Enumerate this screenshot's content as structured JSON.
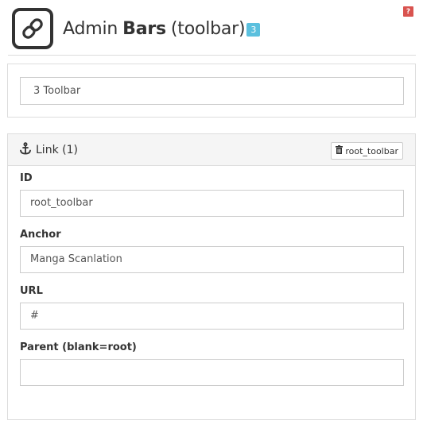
{
  "help_badge": "?",
  "header": {
    "title_pre": "Admin",
    "title_bold": "Bars",
    "title_post": "(toolbar)",
    "count": "3",
    "logo_icon": "link-icon"
  },
  "toolbar_select": {
    "value": "3 Toolbar"
  },
  "panel": {
    "title": "Link (1)",
    "title_icon": "anchor-icon",
    "delete_button": {
      "label": "root_toolbar",
      "icon": "trash-icon"
    }
  },
  "form": {
    "id": {
      "label": "ID",
      "value": "root_toolbar"
    },
    "anchor": {
      "label": "Anchor",
      "value": "Manga Scanlation"
    },
    "url": {
      "label": "URL",
      "value": "#"
    },
    "parent": {
      "label": "Parent (blank=root)",
      "value": ""
    }
  },
  "colors": {
    "badge_info": "#5bc0de",
    "help_badge": "#d9534f",
    "panel_heading_bg": "#f5f5f5",
    "border": "#dddddd"
  }
}
